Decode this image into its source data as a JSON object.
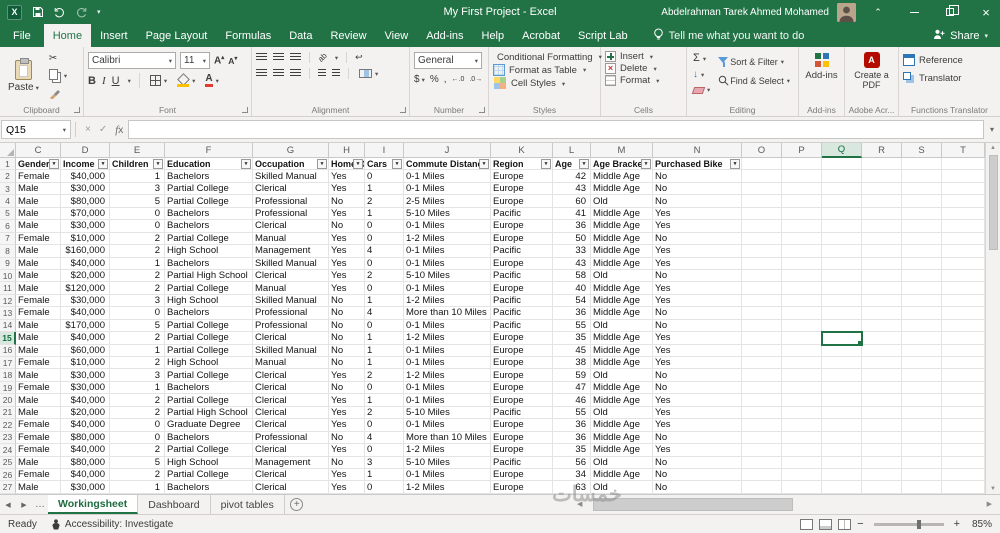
{
  "title_bar": {
    "title": "My First Project  -  Excel",
    "user_name": "Abdelrahman Tarek Ahmed Mohamed"
  },
  "menu": {
    "file": "File",
    "tabs": [
      "Home",
      "Insert",
      "Page Layout",
      "Formulas",
      "Data",
      "Review",
      "View",
      "Add-ins",
      "Help",
      "Acrobat",
      "Script Lab"
    ],
    "active_tab": "Home",
    "tell_me": "Tell me what you want to do",
    "share": "Share"
  },
  "ribbon": {
    "clipboard": {
      "label": "Clipboard",
      "paste": "Paste"
    },
    "font": {
      "label": "Font",
      "name": "Calibri",
      "size": "11"
    },
    "alignment": {
      "label": "Alignment"
    },
    "number": {
      "label": "Number",
      "format": "General"
    },
    "styles": {
      "label": "Styles",
      "conditional_formatting": "Conditional Formatting",
      "format_as_table": "Format as Table",
      "cell_styles": "Cell Styles"
    },
    "cells": {
      "label": "Cells",
      "insert": "Insert",
      "delete": "Delete",
      "format": "Format"
    },
    "editing": {
      "label": "Editing",
      "sort_filter": "Sort & Filter",
      "find_select": "Find & Select"
    },
    "addins": {
      "label": "Add-ins",
      "button": "Add-ins"
    },
    "acrobat": {
      "label": "Adobe Acr...",
      "button": "Create a PDF"
    },
    "functions_translator": {
      "label": "Functions Translator",
      "reference": "Reference",
      "translator": "Translator"
    },
    "icons": {
      "bold": "B",
      "italic": "I",
      "underline": "U",
      "autosum": "Σ",
      "currency": "$",
      "percent": "%",
      "comma": ","
    }
  },
  "formula_bar": {
    "name_box": "Q15",
    "formula": ""
  },
  "sheet": {
    "column_letters": [
      "C",
      "D",
      "E",
      "F",
      "G",
      "H",
      "I",
      "J",
      "K",
      "L",
      "M",
      "N",
      "O",
      "P",
      "Q",
      "R",
      "S",
      "T"
    ],
    "selected_column": "Q",
    "selected_row": 15,
    "selected_cell": "Q15",
    "header_row": [
      "Gender",
      "Income",
      "Children",
      "Education",
      "Occupation",
      "Home Ow",
      "Cars",
      "Commute Distance",
      "Region",
      "Age",
      "Age Bracket",
      "Purchased Bike"
    ],
    "rows": [
      [
        "Female",
        "$40,000",
        "1",
        "Bachelors",
        "Skilled Manual",
        "Yes",
        "0",
        "0-1 Miles",
        "Europe",
        "42",
        "Middle Age",
        "No"
      ],
      [
        "Male",
        "$30,000",
        "3",
        "Partial College",
        "Clerical",
        "Yes",
        "1",
        "0-1 Miles",
        "Europe",
        "43",
        "Middle Age",
        "No"
      ],
      [
        "Male",
        "$80,000",
        "5",
        "Partial College",
        "Professional",
        "No",
        "2",
        "2-5 Miles",
        "Europe",
        "60",
        "Old",
        "No"
      ],
      [
        "Male",
        "$70,000",
        "0",
        "Bachelors",
        "Professional",
        "Yes",
        "1",
        "5-10 Miles",
        "Pacific",
        "41",
        "Middle Age",
        "Yes"
      ],
      [
        "Male",
        "$30,000",
        "0",
        "Bachelors",
        "Clerical",
        "No",
        "0",
        "0-1 Miles",
        "Europe",
        "36",
        "Middle Age",
        "Yes"
      ],
      [
        "Female",
        "$10,000",
        "2",
        "Partial College",
        "Manual",
        "Yes",
        "0",
        "1-2 Miles",
        "Europe",
        "50",
        "Middle Age",
        "No"
      ],
      [
        "Male",
        "$160,000",
        "2",
        "High School",
        "Management",
        "Yes",
        "4",
        "0-1 Miles",
        "Pacific",
        "33",
        "Middle Age",
        "Yes"
      ],
      [
        "Male",
        "$40,000",
        "1",
        "Bachelors",
        "Skilled Manual",
        "Yes",
        "0",
        "0-1 Miles",
        "Europe",
        "43",
        "Middle Age",
        "Yes"
      ],
      [
        "Male",
        "$20,000",
        "2",
        "Partial High School",
        "Clerical",
        "Yes",
        "2",
        "5-10 Miles",
        "Pacific",
        "58",
        "Old",
        "No"
      ],
      [
        "Male",
        "$120,000",
        "2",
        "Partial College",
        "Manual",
        "Yes",
        "0",
        "0-1 Miles",
        "Europe",
        "40",
        "Middle Age",
        "Yes"
      ],
      [
        "Female",
        "$30,000",
        "3",
        "High School",
        "Skilled Manual",
        "No",
        "1",
        "1-2 Miles",
        "Pacific",
        "54",
        "Middle Age",
        "Yes"
      ],
      [
        "Female",
        "$40,000",
        "0",
        "Bachelors",
        "Professional",
        "No",
        "4",
        "More than 10 Miles",
        "Pacific",
        "36",
        "Middle Age",
        "No"
      ],
      [
        "Male",
        "$170,000",
        "5",
        "Partial College",
        "Professional",
        "No",
        "0",
        "0-1 Miles",
        "Pacific",
        "55",
        "Old",
        "No"
      ],
      [
        "Male",
        "$40,000",
        "2",
        "Partial College",
        "Clerical",
        "No",
        "1",
        "1-2 Miles",
        "Europe",
        "35",
        "Middle Age",
        "Yes"
      ],
      [
        "Male",
        "$60,000",
        "1",
        "Partial College",
        "Skilled Manual",
        "No",
        "1",
        "0-1 Miles",
        "Europe",
        "45",
        "Middle Age",
        "Yes"
      ],
      [
        "Female",
        "$10,000",
        "2",
        "High School",
        "Manual",
        "No",
        "1",
        "0-1 Miles",
        "Europe",
        "38",
        "Middle Age",
        "Yes"
      ],
      [
        "Male",
        "$30,000",
        "3",
        "Partial College",
        "Clerical",
        "Yes",
        "2",
        "1-2 Miles",
        "Europe",
        "59",
        "Old",
        "No"
      ],
      [
        "Female",
        "$30,000",
        "1",
        "Bachelors",
        "Clerical",
        "No",
        "0",
        "0-1 Miles",
        "Europe",
        "47",
        "Middle Age",
        "No"
      ],
      [
        "Male",
        "$40,000",
        "2",
        "Partial College",
        "Clerical",
        "Yes",
        "1",
        "0-1 Miles",
        "Europe",
        "46",
        "Middle Age",
        "Yes"
      ],
      [
        "Male",
        "$20,000",
        "2",
        "Partial High School",
        "Clerical",
        "Yes",
        "2",
        "5-10 Miles",
        "Pacific",
        "55",
        "Old",
        "Yes"
      ],
      [
        "Female",
        "$40,000",
        "0",
        "Graduate Degree",
        "Clerical",
        "Yes",
        "0",
        "0-1 Miles",
        "Europe",
        "36",
        "Middle Age",
        "Yes"
      ],
      [
        "Female",
        "$80,000",
        "0",
        "Bachelors",
        "Professional",
        "No",
        "4",
        "More than 10 Miles",
        "Europe",
        "36",
        "Middle Age",
        "No"
      ],
      [
        "Female",
        "$40,000",
        "2",
        "Partial College",
        "Clerical",
        "Yes",
        "0",
        "1-2 Miles",
        "Europe",
        "35",
        "Middle Age",
        "Yes"
      ],
      [
        "Male",
        "$80,000",
        "5",
        "High School",
        "Management",
        "No",
        "3",
        "5-10 Miles",
        "Pacific",
        "56",
        "Old",
        "No"
      ],
      [
        "Female",
        "$40,000",
        "2",
        "Partial College",
        "Clerical",
        "Yes",
        "1",
        "0-1 Miles",
        "Europe",
        "34",
        "Middle Age",
        "No"
      ],
      [
        "Male",
        "$30,000",
        "1",
        "Bachelors",
        "Clerical",
        "Yes",
        "0",
        "1-2 Miles",
        "Europe",
        "63",
        "Old",
        "No"
      ]
    ]
  },
  "sheet_tabs": {
    "tabs": [
      "Workingsheet",
      "Dashboard",
      "pivot tables"
    ],
    "active": "Workingsheet"
  },
  "status_bar": {
    "mode": "Ready",
    "accessibility": "Accessibility: Investigate",
    "zoom": "85%"
  },
  "watermark": "خمسات",
  "colors": {
    "excel_green": "#217346",
    "dark_green": "#185C37"
  }
}
